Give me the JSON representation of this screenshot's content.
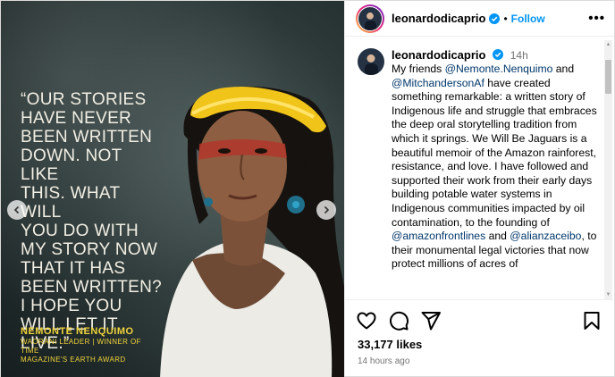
{
  "media": {
    "quote_lines": [
      "“OUR STORIES",
      "HAVE NEVER",
      "BEEN WRITTEN",
      "DOWN. NOT LIKE",
      "THIS. WHAT WILL",
      "YOU DO WITH",
      "MY STORY NOW",
      "THAT IT HAS",
      "BEEN WRITTEN?",
      "I HOPE YOU",
      "WILL LET IT",
      "LIVE.”"
    ],
    "credit_name": "NEMONTE NENQUIMO",
    "credit_role_lines": [
      "WAORANI LEADER | WINNER OF TIME",
      "MAGAZINE'S EARTH AWARD"
    ],
    "prev_icon": "chevron-left-icon",
    "next_icon": "chevron-right-icon"
  },
  "header": {
    "username": "leonardodicaprio",
    "separator": "•",
    "follow_label": "Follow",
    "more_label": "•••"
  },
  "caption": {
    "username": "leonardodicaprio",
    "time": "14h",
    "t1": "My friends ",
    "m1": "@Nemonte.Nenquimo",
    "t2": " and ",
    "m2": "@MitchandersonAf",
    "t3": " have created something remarkable: a written story of Indigenous life and struggle that embraces the deep oral storytelling tradition from which it springs. We Will Be Jaguars is a beautiful memoir of the Amazon rainforest, resistance, and love. I have followed and supported their work from their early days building potable water systems in Indigenous communities impacted by oil contamination, to the founding of ",
    "m3": "@amazonfrontlines",
    "t4": " and ",
    "m4": "@alianzaceibo",
    "t5": ", to their monumental legal victories that now protect millions of acres of"
  },
  "actions": {
    "like_icon": "heart-icon",
    "comment_icon": "comment-icon",
    "share_icon": "share-icon",
    "save_icon": "bookmark-icon",
    "likes": "33,177 likes",
    "ago": "14 hours ago"
  },
  "colors": {
    "accent": "#0095f6",
    "mention": "#00376b",
    "muted": "#737373",
    "quote": "#f2efe4",
    "credit": "#f0d33a"
  }
}
